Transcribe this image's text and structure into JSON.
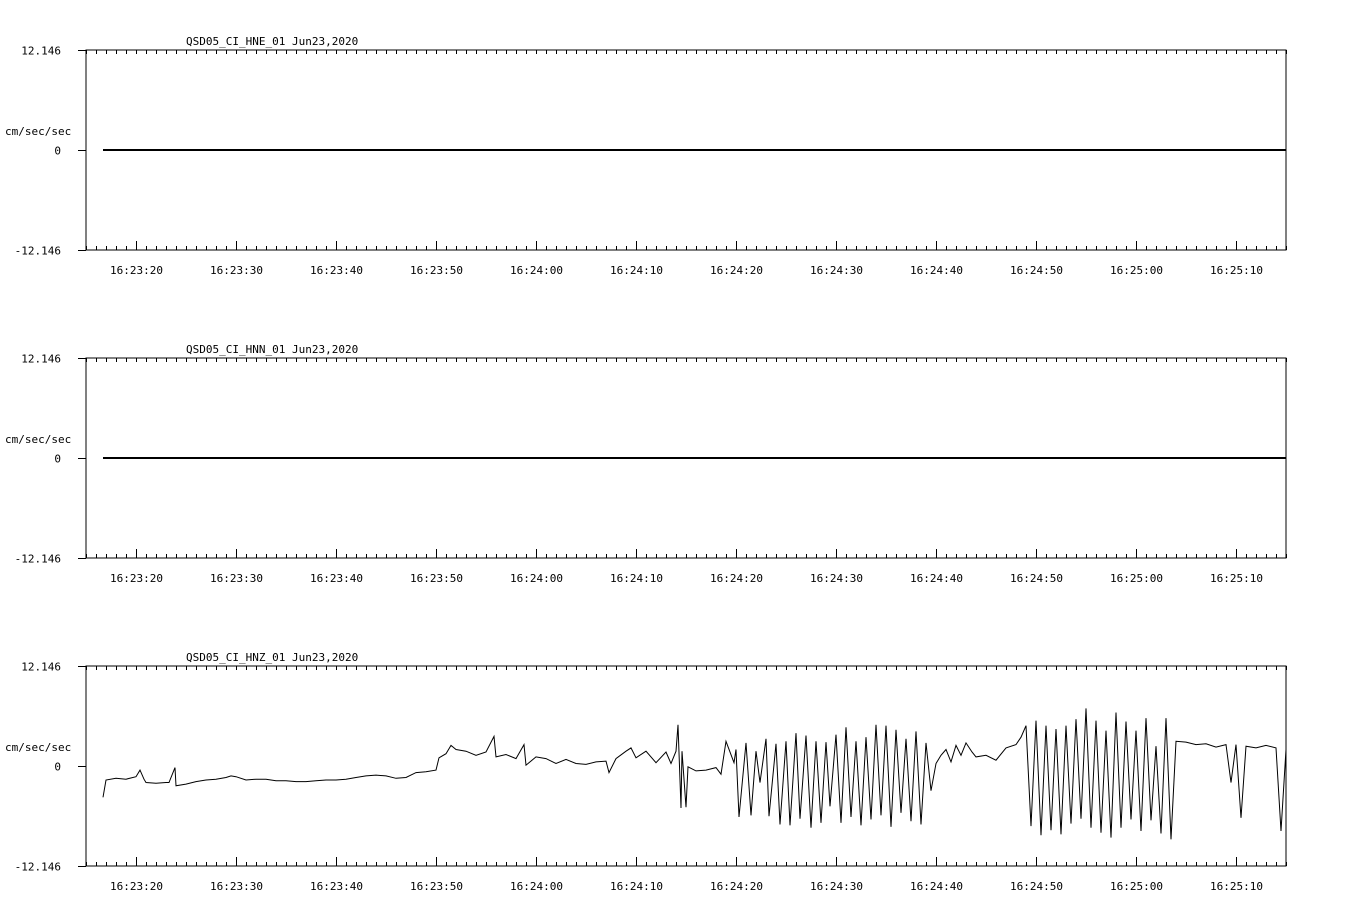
{
  "chart_data": [
    {
      "type": "line",
      "title": "QSD05_CI_HNE_01  Jun23,2020",
      "ylabel": "cm/sec/sec",
      "ylim": [
        -12.146,
        12.146
      ],
      "y_tick_labels": [
        "12.146",
        "0",
        "-12.146"
      ],
      "x_tick_labels": [
        "16:23:20",
        "16:23:30",
        "16:23:40",
        "16:23:50",
        "16:24:00",
        "16:24:10",
        "16:24:20",
        "16:24:30",
        "16:24:40",
        "16:24:50",
        "16:25:00",
        "16:25:10"
      ],
      "x_range_seconds": [
        15,
        135
      ],
      "series": [
        {
          "x": [
            16.7,
            135
          ],
          "y": [
            0,
            0
          ]
        }
      ]
    },
    {
      "type": "line",
      "title": "QSD05_CI_HNN_01  Jun23,2020",
      "ylabel": "cm/sec/sec",
      "ylim": [
        -12.146,
        12.146
      ],
      "y_tick_labels": [
        "12.146",
        "0",
        "-12.146"
      ],
      "x_tick_labels": [
        "16:23:20",
        "16:23:30",
        "16:23:40",
        "16:23:50",
        "16:24:00",
        "16:24:10",
        "16:24:20",
        "16:24:30",
        "16:24:40",
        "16:24:50",
        "16:25:00",
        "16:25:10"
      ],
      "x_range_seconds": [
        15,
        135
      ],
      "series": [
        {
          "x": [
            16.7,
            135
          ],
          "y": [
            0,
            0
          ]
        }
      ]
    },
    {
      "type": "line",
      "title": "QSD05_CI_HNZ_01  Jun23,2020",
      "ylabel": "cm/sec/sec",
      "ylim": [
        -12.146,
        12.146
      ],
      "y_tick_labels": [
        "12.146",
        "0",
        "-12.146"
      ],
      "x_tick_labels": [
        "16:23:20",
        "16:23:30",
        "16:23:40",
        "16:23:50",
        "16:24:00",
        "16:24:10",
        "16:24:20",
        "16:24:30",
        "16:24:40",
        "16:24:50",
        "16:25:00",
        "16:25:10"
      ],
      "x_range_seconds": [
        15,
        135
      ],
      "series": [
        {
          "x": [
            16.7,
            17.0,
            18.0,
            19.0,
            20.0,
            20.4,
            20.8,
            21.0,
            22.0,
            23.0,
            23.3,
            23.9,
            24.0,
            25.0,
            26.0,
            27.0,
            28.0,
            29.0,
            29.5,
            30.0,
            31.0,
            32.0,
            33.0,
            34.0,
            35.0,
            36.0,
            37.0,
            38.0,
            39.0,
            40.0,
            41.0,
            42.0,
            43.0,
            44.0,
            45.0,
            46.0,
            47.0,
            48.0,
            49.0,
            50.0,
            50.3,
            51.0,
            51.5,
            52.0,
            53.0,
            54.0,
            55.0,
            55.8,
            56.0,
            57.0,
            58.0,
            58.8,
            59.0,
            60.0,
            61.0,
            62.0,
            63.0,
            64.0,
            65.0,
            66.0,
            67.0,
            67.3,
            68.0,
            69.0,
            69.5,
            70.0,
            71.0,
            72.0,
            73.0,
            73.5,
            74.0,
            74.2,
            74.5,
            74.6,
            75.0,
            75.2,
            76.0,
            77.0,
            78.0,
            78.5,
            79.0,
            79.8,
            80.0,
            80.3,
            81.0,
            81.5,
            82.0,
            82.4,
            83.0,
            83.3,
            84.0,
            84.4,
            85.0,
            85.4,
            86.0,
            86.4,
            87.0,
            87.5,
            88.0,
            88.5,
            89.0,
            89.4,
            90.0,
            90.5,
            91.0,
            91.5,
            92.0,
            92.5,
            93.0,
            93.5,
            94.0,
            94.5,
            95.0,
            95.5,
            96.0,
            96.5,
            97.0,
            97.5,
            98.0,
            98.5,
            99.0,
            99.5,
            100.0,
            100.5,
            101.0,
            101.5,
            102.0,
            102.5,
            103.0,
            103.6,
            104.0,
            105.0,
            106.0,
            107.0,
            108.0,
            108.5,
            109.0,
            109.5,
            110.0,
            110.5,
            111.0,
            111.5,
            112.0,
            112.5,
            113.0,
            113.5,
            114.0,
            114.5,
            115.0,
            115.5,
            116.0,
            116.5,
            117.0,
            117.5,
            118.0,
            118.5,
            119.0,
            119.5,
            120.0,
            120.5,
            121.0,
            121.5,
            122.0,
            122.5,
            123.0,
            123.5,
            124.0,
            125.0,
            126.0,
            127.0,
            128.0,
            129.0,
            129.5,
            130.0,
            130.5,
            131.0,
            132.0,
            133.0,
            134.0,
            134.5,
            135.0
          ],
          "y": [
            -3.8,
            -1.7,
            -1.5,
            -1.6,
            -1.3,
            -0.5,
            -1.6,
            -2.0,
            -2.1,
            -2.0,
            -2.0,
            -0.2,
            -2.4,
            -2.2,
            -1.9,
            -1.7,
            -1.6,
            -1.4,
            -1.2,
            -1.3,
            -1.7,
            -1.6,
            -1.6,
            -1.8,
            -1.8,
            -1.9,
            -1.9,
            -1.8,
            -1.7,
            -1.7,
            -1.6,
            -1.4,
            -1.2,
            -1.1,
            -1.2,
            -1.5,
            -1.4,
            -0.8,
            -0.7,
            -0.5,
            1.0,
            1.5,
            2.5,
            2.0,
            1.8,
            1.3,
            1.7,
            3.6,
            1.1,
            1.4,
            0.9,
            2.6,
            0.1,
            1.1,
            0.9,
            0.3,
            0.8,
            0.3,
            0.2,
            0.5,
            0.6,
            -0.8,
            0.9,
            1.8,
            2.2,
            1.0,
            1.8,
            0.4,
            1.7,
            0.3,
            1.8,
            5.0,
            -5.1,
            1.8,
            -5.0,
            -0.1,
            -0.6,
            -0.5,
            -0.2,
            -1.0,
            3.0,
            0.4,
            2.0,
            -6.2,
            2.8,
            -6.0,
            1.8,
            -2.0,
            3.3,
            -6.1,
            2.7,
            -7.1,
            3.0,
            -7.2,
            4.0,
            -6.4,
            3.7,
            -7.5,
            3.0,
            -6.9,
            2.9,
            -4.9,
            3.8,
            -6.9,
            4.7,
            -6.2,
            3.0,
            -7.2,
            3.5,
            -6.5,
            5.0,
            -6.0,
            4.9,
            -7.4,
            4.4,
            -5.7,
            3.3,
            -6.7,
            4.2,
            -7.1,
            2.8,
            -3.0,
            0.3,
            1.3,
            2.0,
            0.5,
            2.5,
            1.3,
            2.8,
            1.7,
            1.1,
            1.3,
            0.7,
            2.2,
            2.6,
            3.5,
            4.9,
            -7.3,
            5.5,
            -8.4,
            4.9,
            -7.8,
            4.5,
            -8.3,
            4.9,
            -7.0,
            5.7,
            -6.4,
            7.0,
            -7.5,
            5.5,
            -8.1,
            4.3,
            -8.7,
            6.5,
            -7.5,
            5.4,
            -6.5,
            4.3,
            -7.9,
            5.8,
            -6.6,
            2.4,
            -8.2,
            5.8,
            -8.9,
            3.0,
            2.9,
            2.6,
            2.7,
            2.3,
            2.6,
            -2.0,
            2.6,
            -6.3,
            2.4,
            2.2,
            2.5,
            2.2,
            -7.9,
            2.0
          ]
        }
      ]
    }
  ]
}
